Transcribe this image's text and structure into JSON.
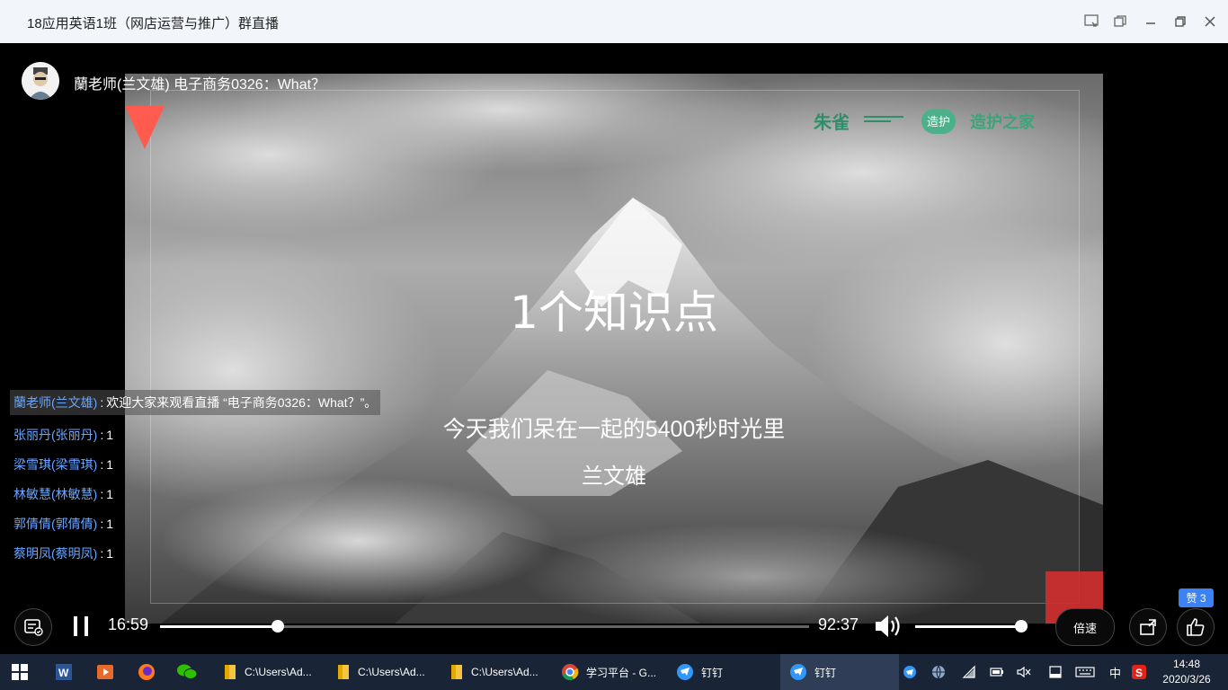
{
  "window": {
    "title": "18应用英语1班（网店运营与推广）群直播"
  },
  "presenter": {
    "label": "蘭老师(兰文雄) 电子商务0326：What？"
  },
  "slide": {
    "headline": "1个知识点",
    "subline": "今天我们呆在一起的5400秒时光里",
    "author": "兰文雄",
    "logos": [
      "朱雀",
      "造护",
      "造护之家"
    ]
  },
  "chat": {
    "messages": [
      {
        "name": "蘭老师(兰文雄)",
        "text": "欢迎大家来观看直播 “电子商务0326：What？”。"
      },
      {
        "name": "张丽丹(张丽丹)",
        "text": "1"
      },
      {
        "name": "梁雪琪(梁雪琪)",
        "text": "1"
      },
      {
        "name": "林敏慧(林敏慧)",
        "text": "1"
      },
      {
        "name": "郭倩倩(郭倩倩)",
        "text": "1"
      },
      {
        "name": "蔡明凤(蔡明凤)",
        "text": "1"
      }
    ]
  },
  "player": {
    "current_time": "16:59",
    "total_time": "92:37",
    "progress": 0.181,
    "volume": 0.98,
    "speed_label": "倍速",
    "like_badge": "赞 3"
  },
  "taskbar": {
    "items": [
      {
        "label": "C:\\Users\\Ad..."
      },
      {
        "label": "C:\\Users\\Ad..."
      },
      {
        "label": "C:\\Users\\Ad..."
      },
      {
        "label": "学习平台 - G..."
      },
      {
        "label": "钉钉"
      },
      {
        "label": "钉钉"
      }
    ],
    "ime": "中",
    "clock_time": "14:48",
    "clock_date": "2020/3/26"
  }
}
